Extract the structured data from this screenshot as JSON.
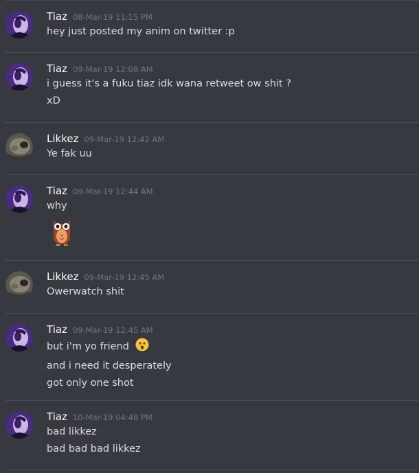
{
  "messages": [
    {
      "author": "Tiaz",
      "timestamp": "08-Mar-19 11:15 PM",
      "avatar": "tiaz-avatar",
      "lines": [
        "hey just posted my anim on twitter :p"
      ]
    },
    {
      "author": "Tiaz",
      "timestamp": "09-Mar-19 12:08 AM",
      "avatar": "tiaz-avatar",
      "lines": [
        "i guess it's a fuku tiaz idk wana retweet ow shit ?",
        "xD"
      ]
    },
    {
      "author": "Likkez",
      "timestamp": "09-Mar-19 12:42 AM",
      "avatar": "likkez-avatar",
      "lines": [
        "Ye fak uu"
      ]
    },
    {
      "author": "Tiaz",
      "timestamp": "09-Mar-19 12:44 AM",
      "avatar": "tiaz-avatar",
      "lines": [
        "why"
      ],
      "emoji": "owl-emoji"
    },
    {
      "author": "Likkez",
      "timestamp": "09-Mar-19 12:45 AM",
      "avatar": "likkez-avatar",
      "lines": [
        "Owerwatch shit"
      ]
    },
    {
      "author": "Tiaz",
      "timestamp": "09-Mar-19 12:45 AM",
      "avatar": "tiaz-avatar",
      "lines": [
        "but i'm yo friend",
        "and i need it desperately",
        "got only one shot"
      ],
      "inline_emoji": "hushed-face-emoji"
    },
    {
      "author": "Tiaz",
      "timestamp": "10-Mar-19 04:48 PM",
      "avatar": "tiaz-avatar",
      "lines": [
        "bad likkez",
        "bad bad bad likkez"
      ]
    }
  ],
  "colors": {
    "background": "#36393f",
    "username": "#ffffff",
    "timestamp": "#72767d",
    "text": "#dcddde",
    "divider": "#4a4d53"
  }
}
